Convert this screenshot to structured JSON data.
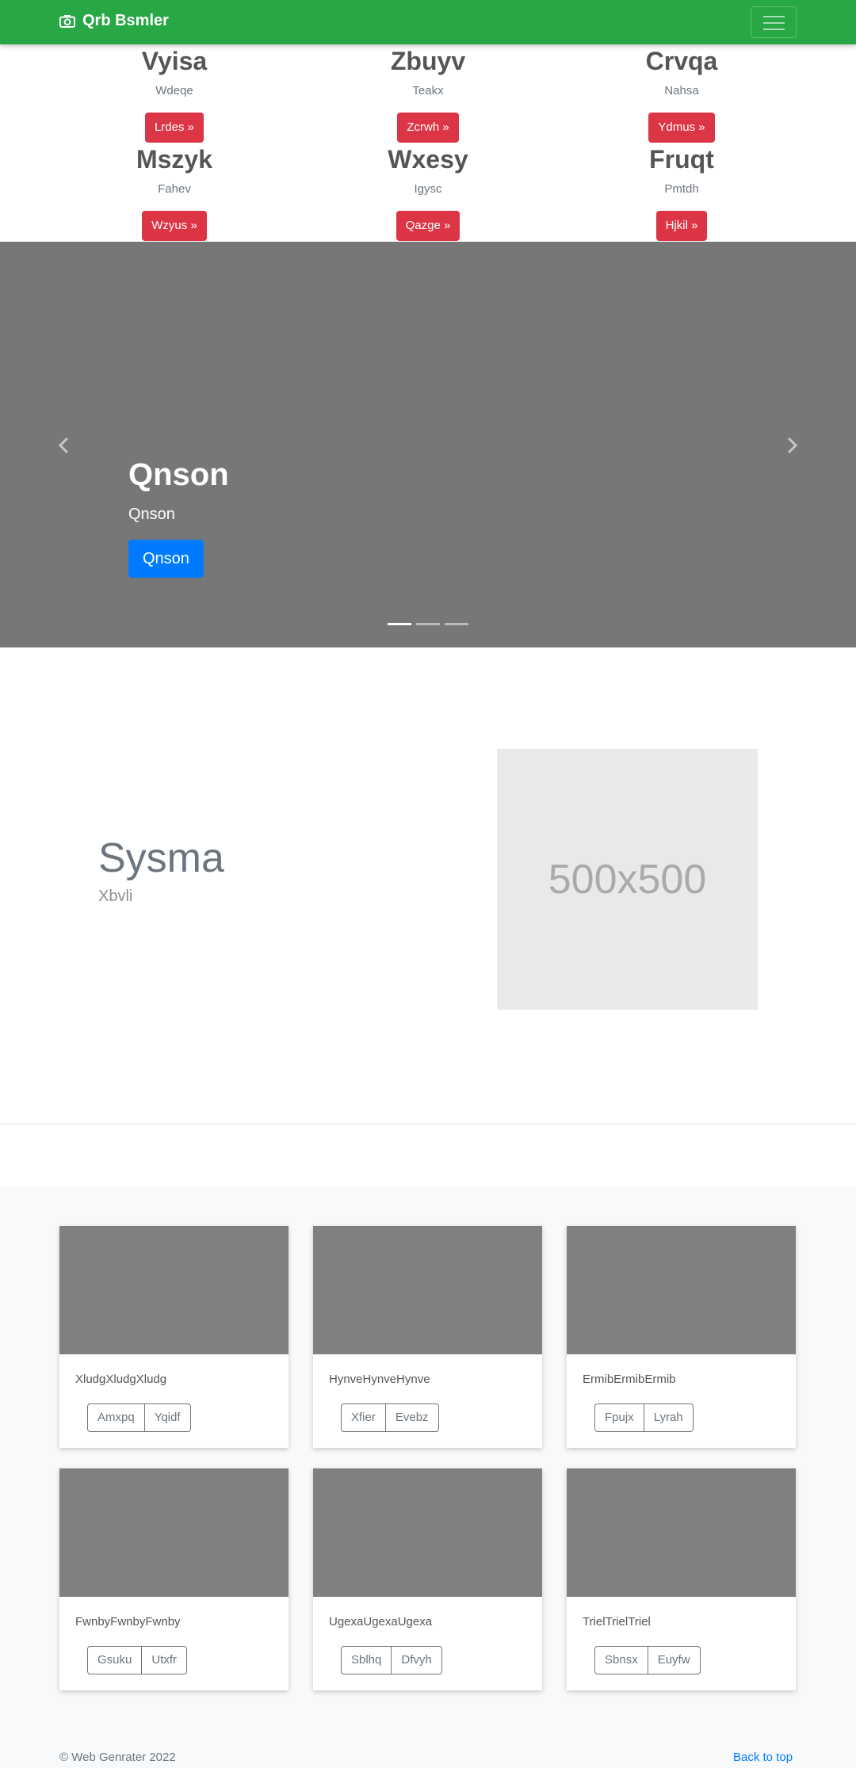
{
  "navbar": {
    "brand": "Qrb Bsmler"
  },
  "grid": [
    {
      "heading": "Vyisa",
      "sub": "Wdeqe",
      "button": "Lrdes »"
    },
    {
      "heading": "Zbuyv",
      "sub": "Teakx",
      "button": "Zcrwh »"
    },
    {
      "heading": "Crvqa",
      "sub": "Nahsa",
      "button": "Ydmus »"
    },
    {
      "heading": "Mszyk",
      "sub": "Fahev",
      "button": "Wzyus »"
    },
    {
      "heading": "Wxesy",
      "sub": "Igysc",
      "button": "Qazge »"
    },
    {
      "heading": "Fruqt",
      "sub": "Pmtdh",
      "button": "Hjkil »"
    }
  ],
  "carousel": {
    "title": "Qnson",
    "text": "Qnson",
    "button": "Qnson",
    "slide_count": 3,
    "active_slide": 1
  },
  "feature": {
    "title": "Sysma",
    "subtitle": "Xbvli",
    "placeholder": "500x500"
  },
  "cards": [
    {
      "text": "XludgXludgXludg",
      "buttons": [
        "Amxpq",
        "Yqidf"
      ]
    },
    {
      "text": "HynveHynveHynve",
      "buttons": [
        "Xfier",
        "Evebz"
      ]
    },
    {
      "text": "ErmibErmibErmib",
      "buttons": [
        "Fpujx",
        "Lyrah"
      ]
    },
    {
      "text": "FwnbyFwnbyFwnby",
      "buttons": [
        "Gsuku",
        "Utxfr"
      ]
    },
    {
      "text": "UgexaUgexaUgexa",
      "buttons": [
        "Sblhq",
        "Dfvyh"
      ]
    },
    {
      "text": "TrielTrielTriel",
      "buttons": [
        "Sbnsx",
        "Euyfw"
      ]
    }
  ],
  "footer": {
    "copyright": "© Web Genrater 2022",
    "back_to_top": "Back to top"
  },
  "colors": {
    "navbar": "#28a745",
    "danger": "#dc3545",
    "primary": "#007bff",
    "carousel_bg": "#777777",
    "card_image": "#808080"
  }
}
